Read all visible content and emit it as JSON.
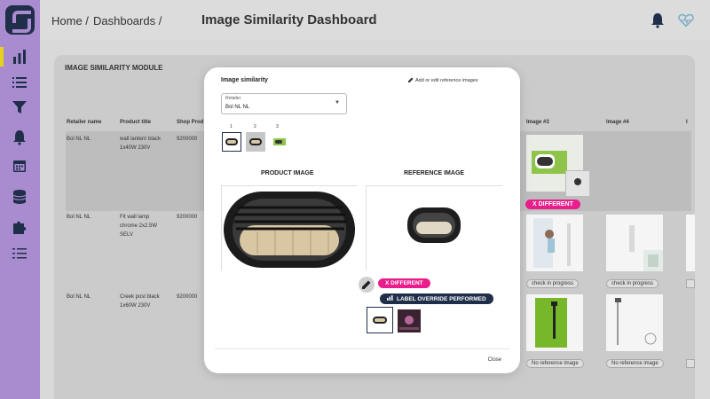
{
  "header": {
    "breadcrumb_home": "Home /",
    "breadcrumb_dashboards": "Dashboards /",
    "title": "Image Similarity Dashboard"
  },
  "sidebar": {
    "items": [
      {
        "icon": "bar-chart-icon"
      },
      {
        "icon": "list-icon"
      },
      {
        "icon": "filter-icon"
      },
      {
        "icon": "bell-icon"
      },
      {
        "icon": "calendar-icon"
      },
      {
        "icon": "database-icon"
      },
      {
        "icon": "puzzle-icon"
      },
      {
        "icon": "checklist-icon"
      }
    ]
  },
  "module": {
    "title": "IMAGE SIMILARITY MODULE",
    "columns": [
      "Retailer name",
      "Product title",
      "Shop Prod",
      "Image #3",
      "Image #4",
      "I"
    ],
    "rows": [
      {
        "retailer": "Bol NL NL",
        "title": "wall lantern black 1x40W 230V",
        "shop": "9200000"
      },
      {
        "retailer": "Bol NL NL",
        "title": "Fit wall lamp chrome 2x2.5W SELV",
        "shop": "9200000"
      },
      {
        "retailer": "Bol NL NL",
        "title": "Creek post black 1x60W 230V",
        "shop": "9200000"
      }
    ],
    "status": {
      "different": "X  DIFFERENT",
      "check_in_progress": "check in progress",
      "no_reference_image": "No reference image"
    }
  },
  "modal": {
    "title": "Image similarity",
    "edit_link": "Add or edit reference images",
    "select_label": "Retailer",
    "select_value": "Bol NL NL",
    "indices": [
      "1",
      "2",
      "3"
    ],
    "product_image_label": "PRODUCT IMAGE",
    "reference_image_label": "REFERENCE IMAGE",
    "different_label": "X  DIFFERENT",
    "override_label": "LABEL OVERRIDE PERFORMED",
    "close_label": "Close"
  },
  "colors": {
    "sidebar": "#a98bcf",
    "accent": "#e91e8c",
    "override": "#1f2f4a",
    "logo": "#1f2f4a"
  }
}
